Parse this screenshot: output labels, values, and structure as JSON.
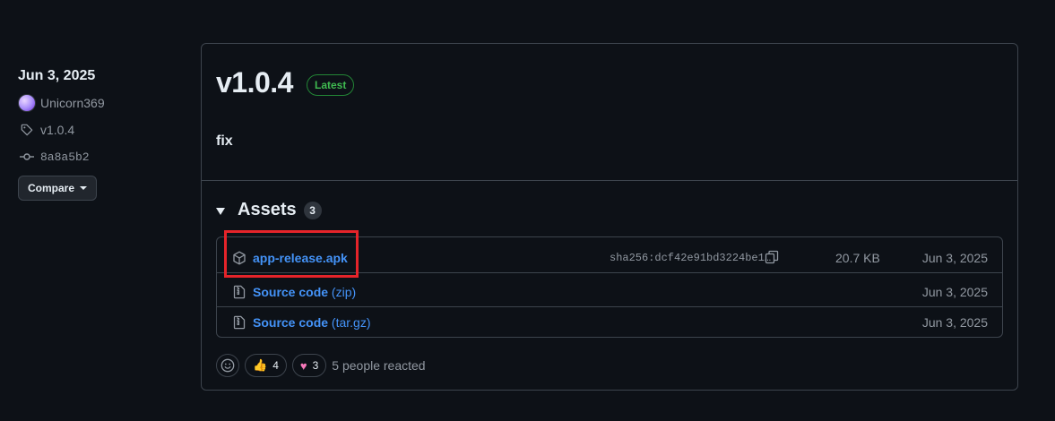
{
  "sidebar": {
    "date": "Jun 3, 2025",
    "author": "Unicorn369",
    "tag": "v1.0.4",
    "commit": "8a8a5b2",
    "compare_label": "Compare"
  },
  "release": {
    "title": "v1.0.4",
    "latest_label": "Latest",
    "body": "fix"
  },
  "assets": {
    "title": "Assets",
    "count": "3",
    "items": [
      {
        "name": "app-release.apk",
        "ext": "",
        "sha": "sha256:dcf42e91bd3224be1…",
        "size": "20.7 KB",
        "date": "Jun 3, 2025",
        "icon": "package-icon"
      },
      {
        "name": "Source code",
        "ext": "(zip)",
        "sha": "",
        "size": "",
        "date": "Jun 3, 2025",
        "icon": "file-zip-icon"
      },
      {
        "name": "Source code",
        "ext": "(tar.gz)",
        "sha": "",
        "size": "",
        "date": "Jun 3, 2025",
        "icon": "file-zip-icon"
      }
    ]
  },
  "reactions": {
    "thumbs_count": "4",
    "heart_count": "3",
    "summary": "5 people reacted"
  },
  "colors": {
    "accent_link": "#4493f8",
    "latest_green": "#3fb950",
    "highlight_red": "#e5242a"
  }
}
